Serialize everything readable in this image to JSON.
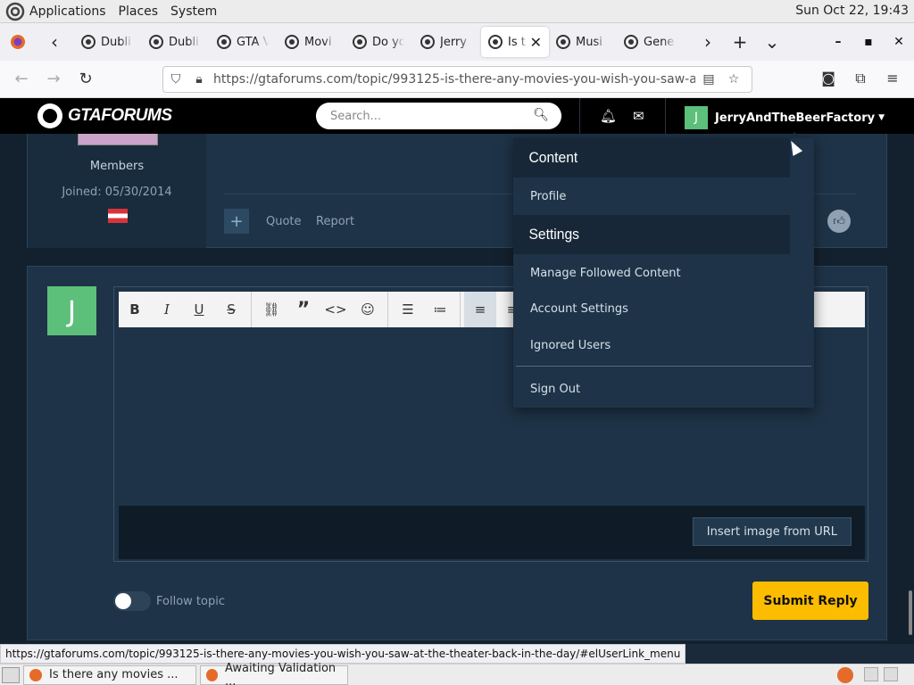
{
  "system_panel": {
    "menus": [
      "Applications",
      "Places",
      "System"
    ],
    "clock": "Sun Oct 22, 19:43"
  },
  "browser": {
    "tabs": [
      {
        "title": "Dubli"
      },
      {
        "title": "Dubli"
      },
      {
        "title": "GTA V"
      },
      {
        "title": "Movi"
      },
      {
        "title": "Do yo"
      },
      {
        "title": "Jerry"
      },
      {
        "title": "Is t",
        "active": true
      },
      {
        "title": "Musi"
      },
      {
        "title": "Gene"
      }
    ],
    "url": "https://gtaforums.com/topic/993125-is-there-any-movies-you-wish-you-saw-at-the-t",
    "status_url": "https://gtaforums.com/topic/993125-is-there-any-movies-you-wish-you-saw-at-the-theater-back-in-the-day/#elUserLink_menu"
  },
  "site": {
    "logo": "GTAFORUMS",
    "search_placeholder": "Search...",
    "username": "JerryAndTheBeerFactory",
    "user_initial": "J"
  },
  "post": {
    "group": "Members",
    "joined": "Joined: 05/30/2014",
    "actions": {
      "quote": "Quote",
      "report": "Report"
    }
  },
  "editor": {
    "insert_image": "Insert image from URL",
    "follow_label": "Follow topic",
    "submit": "Submit Reply",
    "reply_initial": "J"
  },
  "dropdown": {
    "content_heading": "Content",
    "profile": "Profile",
    "settings_heading": "Settings",
    "manage_followed": "Manage Followed Content",
    "account_settings": "Account Settings",
    "ignored_users": "Ignored Users",
    "sign_out": "Sign Out"
  },
  "taskbar": {
    "items": [
      "Is there any movies ...",
      "Awaiting Validation ..."
    ]
  },
  "colors": {
    "accent_submit": "#fcbc00",
    "avatar_green": "#5cbf7a",
    "panel_dark": "#1e3347"
  }
}
